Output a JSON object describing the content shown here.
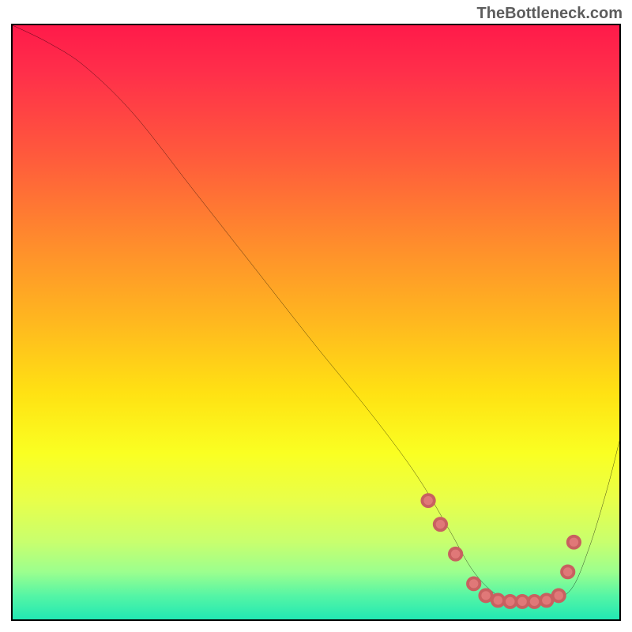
{
  "watermark": "TheBottleneck.com",
  "chart_data": {
    "type": "line",
    "title": "",
    "xlabel": "",
    "ylabel": "",
    "xlim": [
      0,
      100
    ],
    "ylim": [
      0,
      100
    ],
    "grid": false,
    "legend": false,
    "series": [
      {
        "name": "curve",
        "x": [
          0,
          6,
          12,
          20,
          30,
          40,
          50,
          58,
          64,
          68,
          72,
          76,
          80,
          84,
          88,
          92,
          95,
          98,
          100
        ],
        "y": [
          100,
          97,
          93,
          85,
          72,
          59,
          46,
          36,
          28,
          22,
          15,
          8,
          4,
          3,
          3,
          5,
          12,
          22,
          30
        ]
      }
    ],
    "markers": {
      "name": "highlight-points",
      "x": [
        68.5,
        70.5,
        73,
        76,
        78,
        80,
        82,
        84,
        86,
        88,
        90,
        91.5,
        92.5
      ],
      "y": [
        20,
        16,
        11,
        6,
        4,
        3.2,
        3,
        3,
        3,
        3.2,
        4,
        8,
        13
      ]
    },
    "background": "vertical-gradient red→orange→yellow→green"
  }
}
